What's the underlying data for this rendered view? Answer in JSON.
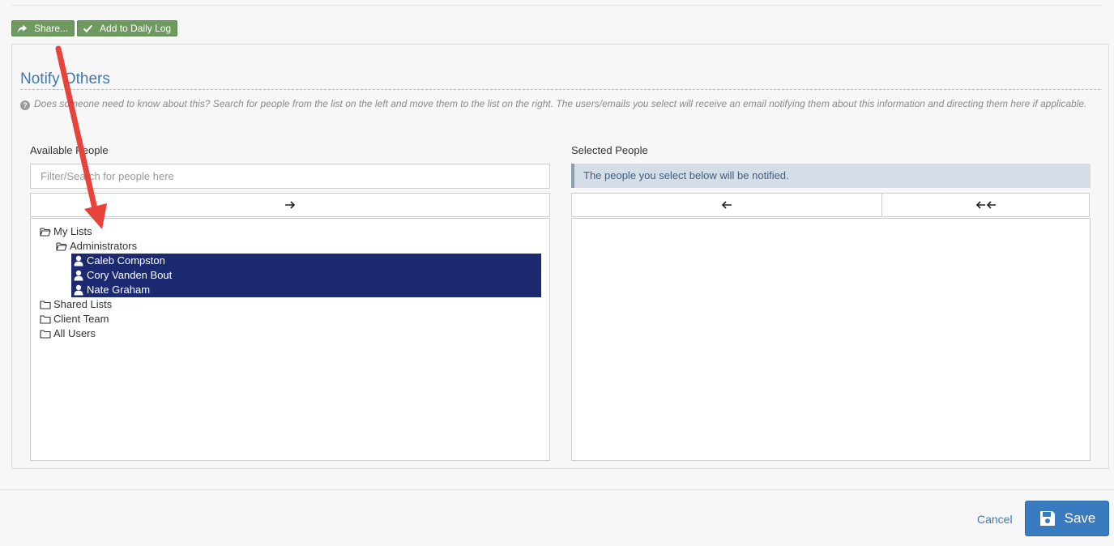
{
  "toolbar": {
    "share_label": "Share...",
    "daily_log_label": "Add to Daily Log"
  },
  "notify": {
    "title": "Notify Others",
    "help": "Does someone need to know about this? Search for people from the list on the left and move them to the list on the right. The users/emails you select will receive an email notifying them about this information and directing them here if applicable."
  },
  "available": {
    "label": "Available People",
    "search_placeholder": "Filter/Search for people here",
    "tree": {
      "my_lists": "My Lists",
      "administrators": "Administrators",
      "people": [
        "Caleb Compston",
        "Cory Vanden Bout",
        "Nate Graham"
      ],
      "shared_lists": "Shared Lists",
      "client_team": "Client Team",
      "all_users": "All Users"
    }
  },
  "selected": {
    "label": "Selected People",
    "info": "The people you select below will be notified."
  },
  "footer": {
    "cancel_label": "Cancel",
    "save_label": "Save"
  },
  "colors": {
    "accent": "#3e79b4",
    "toolbar_green": "#6e9a60",
    "selection_navy": "#1c2a72",
    "annotation_red": "#e8433a"
  }
}
